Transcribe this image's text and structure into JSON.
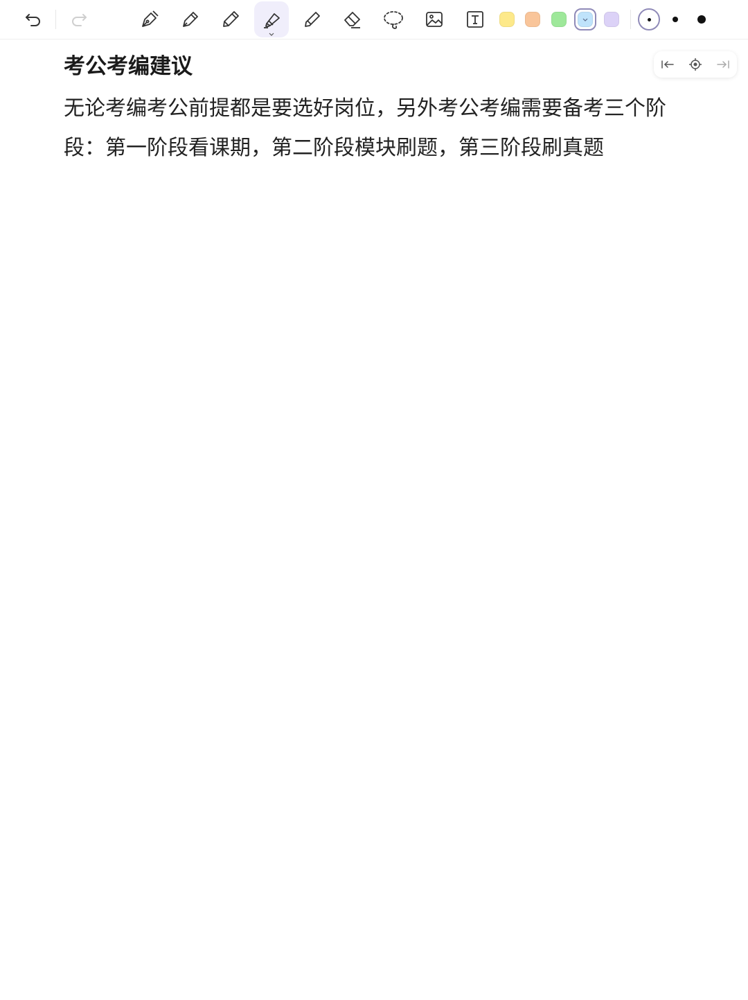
{
  "toolbar": {
    "undo_icon": "undo-icon",
    "redo_icon": "redo-icon",
    "tools": [
      {
        "name": "fountain-pen-icon"
      },
      {
        "name": "ballpoint-pen-icon"
      },
      {
        "name": "pencil-icon"
      },
      {
        "name": "highlighter-icon",
        "active": true
      },
      {
        "name": "brush-icon"
      },
      {
        "name": "eraser-icon"
      },
      {
        "name": "lasso-icon"
      },
      {
        "name": "image-icon"
      },
      {
        "name": "text-box-icon"
      }
    ],
    "colors": [
      {
        "name": "yellow",
        "hex": "#fde98a"
      },
      {
        "name": "orange",
        "hex": "#f9c59a"
      },
      {
        "name": "green",
        "hex": "#9ee89a"
      },
      {
        "name": "blue",
        "hex": "#bfe3fb",
        "selected": true
      },
      {
        "name": "purple",
        "hex": "#dcd2f7"
      }
    ],
    "sizes": [
      "small",
      "medium",
      "large"
    ],
    "accent": "#8f8ab8"
  },
  "pager": {
    "prev_icon": "page-start-icon",
    "locate_icon": "locate-icon",
    "next_icon": "page-end-icon"
  },
  "document": {
    "title": "考公考编建议",
    "body": "无论考编考公前提都是要选好岗位，另外考公考编需要备考三个阶段：第一阶段看课期，第二阶段模块刷题，第三阶段刷真题"
  }
}
